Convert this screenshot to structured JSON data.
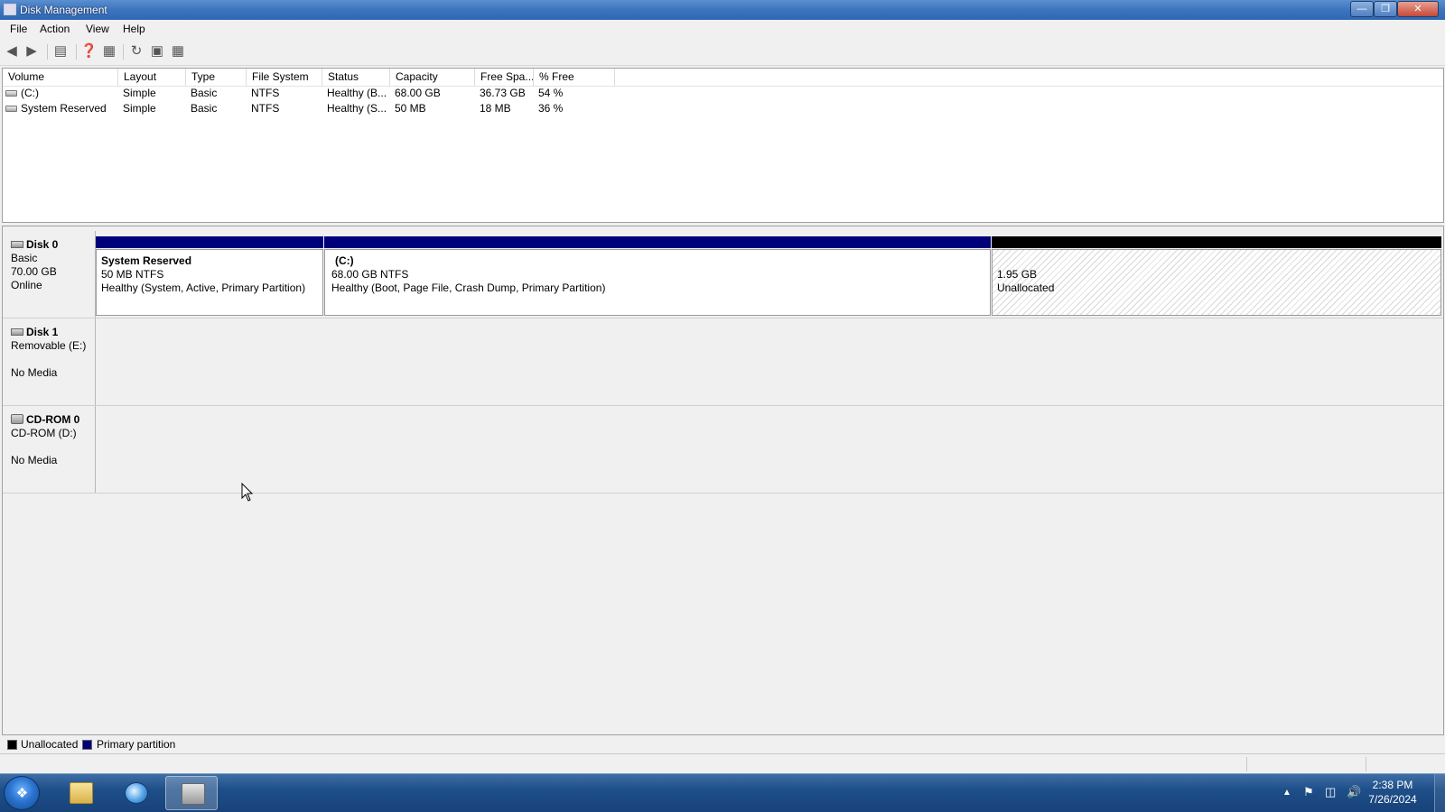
{
  "window": {
    "title": "Disk Management"
  },
  "menu": [
    "File",
    "Action",
    "View",
    "Help"
  ],
  "volume_table": {
    "columns": [
      "Volume",
      "Layout",
      "Type",
      "File System",
      "Status",
      "Capacity",
      "Free Spa...",
      "% Free"
    ],
    "rows": [
      {
        "volume": "(C:)",
        "layout": "Simple",
        "type": "Basic",
        "fs": "NTFS",
        "status": "Healthy (B...",
        "capacity": "68.00 GB",
        "free": "36.73 GB",
        "pct": "54 %"
      },
      {
        "volume": "System Reserved",
        "layout": "Simple",
        "type": "Basic",
        "fs": "NTFS",
        "status": "Healthy (S...",
        "capacity": "50 MB",
        "free": "18 MB",
        "pct": "36 %"
      }
    ]
  },
  "disks": [
    {
      "name": "Disk 0",
      "line1": "Basic",
      "line2": "70.00 GB",
      "line3": "Online",
      "partitions": [
        {
          "name": "System Reserved",
          "size": "50 MB NTFS",
          "status": "Healthy (System, Active, Primary Partition)"
        },
        {
          "name": "(C:)",
          "size": "68.00 GB NTFS",
          "status": "Healthy (Boot, Page File, Crash Dump, Primary Partition)"
        },
        {
          "size": "1.95 GB",
          "status": "Unallocated"
        }
      ]
    },
    {
      "name": "Disk 1",
      "line1": "Removable (E:)",
      "line3": "No Media"
    },
    {
      "name": "CD-ROM 0",
      "line1": "CD-ROM (D:)",
      "line3": "No Media"
    }
  ],
  "legend": {
    "unallocated": "Unallocated",
    "primary": "Primary partition",
    "unallocated_color": "#000000",
    "primary_color": "#00007a"
  },
  "taskbar": {
    "time": "2:38 PM",
    "date": "7/26/2024"
  }
}
